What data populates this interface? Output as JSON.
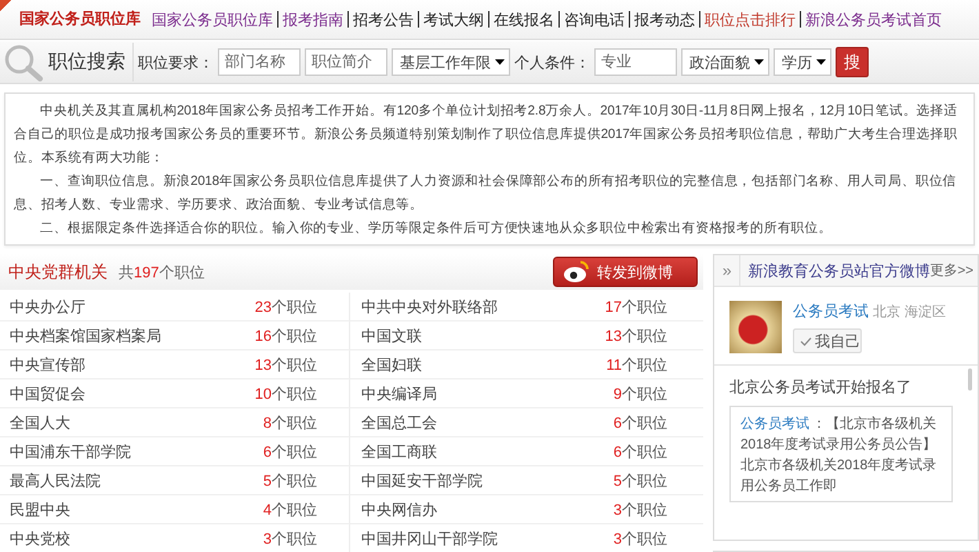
{
  "nav": {
    "brand": "国家公务员职位库",
    "items": [
      {
        "label": "国家公务员职位库",
        "color": "#7a2a8c"
      },
      {
        "label": "报考指南",
        "color": "#7a2a8c"
      },
      {
        "label": "招考公告",
        "color": "#222222"
      },
      {
        "label": "考试大纲",
        "color": "#222222"
      },
      {
        "label": "在线报名",
        "color": "#222222"
      },
      {
        "label": "咨询电话",
        "color": "#222222"
      },
      {
        "label": "报考动态",
        "color": "#222222"
      },
      {
        "label": "职位点击排行",
        "color": "#c0392b"
      },
      {
        "label": "新浪公务员考试首页",
        "color": "#7a2a8c"
      }
    ]
  },
  "search": {
    "title": "职位搜索",
    "fields": [
      {
        "kind": "label",
        "text": "职位要求："
      },
      {
        "kind": "input",
        "placeholder": "部门名称"
      },
      {
        "kind": "input",
        "placeholder": "职位简介"
      },
      {
        "kind": "select",
        "value": "基层工作年限"
      },
      {
        "kind": "label",
        "text": "个人条件："
      },
      {
        "kind": "input",
        "placeholder": "专业"
      },
      {
        "kind": "select",
        "value": "政治面貌"
      },
      {
        "kind": "select",
        "value": "学历"
      }
    ],
    "button": "搜"
  },
  "intro": [
    "中央机关及其直属机构2018年国家公务员招考工作开始。有120多个单位计划招考2.8万余人。2017年10月30日-11月8日网上报名，12月10日笔试。选择适合自己的职位是成功报考国家公务员的重要环节。新浪公务员频道特别策划制作了职位信息库提供2017年国家公务员招考职位信息，帮助广大考生合理选择职位。本系统有两大功能：",
    "一、查询职位信息。新浪2018年国家公务员职位信息库提供了人力资源和社会保障部公布的所有招考职位的完整信息，包括部门名称、用人司局、职位信息、招考人数、专业需求、学历要求、政治面貌、专业考试信息等。",
    "二、根据限定条件选择适合你的职位。输入你的专业、学历等限定条件后可方便快速地从众多职位中检索出有资格报考的所有职位。"
  ],
  "section": {
    "title": "中央党群机关",
    "total_prefix": "共",
    "total": "197",
    "total_suffix": "个职位",
    "share_button": "转发到微博",
    "units": [
      {
        "name": "中央办公厅",
        "count": "23",
        "unit": "个职位"
      },
      {
        "name": "中共中央对外联络部",
        "count": "17",
        "unit": "个职位"
      },
      {
        "name": "中央档案馆国家档案局",
        "count": "16",
        "unit": "个职位"
      },
      {
        "name": "中国文联",
        "count": "13",
        "unit": "个职位"
      },
      {
        "name": "中央宣传部",
        "count": "13",
        "unit": "个职位"
      },
      {
        "name": "全国妇联",
        "count": "11",
        "unit": "个职位"
      },
      {
        "name": "中国贸促会",
        "count": "10",
        "unit": "个职位"
      },
      {
        "name": "中央编译局",
        "count": "9",
        "unit": "个职位"
      },
      {
        "name": "全国人大",
        "count": "8",
        "unit": "个职位"
      },
      {
        "name": "全国总工会",
        "count": "6",
        "unit": "个职位"
      },
      {
        "name": "中国浦东干部学院",
        "count": "6",
        "unit": "个职位"
      },
      {
        "name": "全国工商联",
        "count": "6",
        "unit": "个职位"
      },
      {
        "name": "最高人民法院",
        "count": "5",
        "unit": "个职位"
      },
      {
        "name": "中国延安干部学院",
        "count": "5",
        "unit": "个职位"
      },
      {
        "name": "民盟中央",
        "count": "4",
        "unit": "个职位"
      },
      {
        "name": "中央网信办",
        "count": "3",
        "unit": "个职位"
      },
      {
        "name": "中央党校",
        "count": "3",
        "unit": "个职位"
      },
      {
        "name": "中国井冈山干部学院",
        "count": "3",
        "unit": "个职位"
      }
    ]
  },
  "weibo": {
    "chevron": "»",
    "title": "新浪教育公务员站官方微博",
    "more": "更多>>",
    "account": "公务员考试",
    "location": "北京 海淀区",
    "self_button": "我自己",
    "post": "北京公务员考试开始报名了",
    "quote_author": "公务员考试",
    "quote_text": "：【北京市各级机关2018年度考试录用公务员公告】北京市各级机关2018年度考试录用公务员工作即"
  }
}
